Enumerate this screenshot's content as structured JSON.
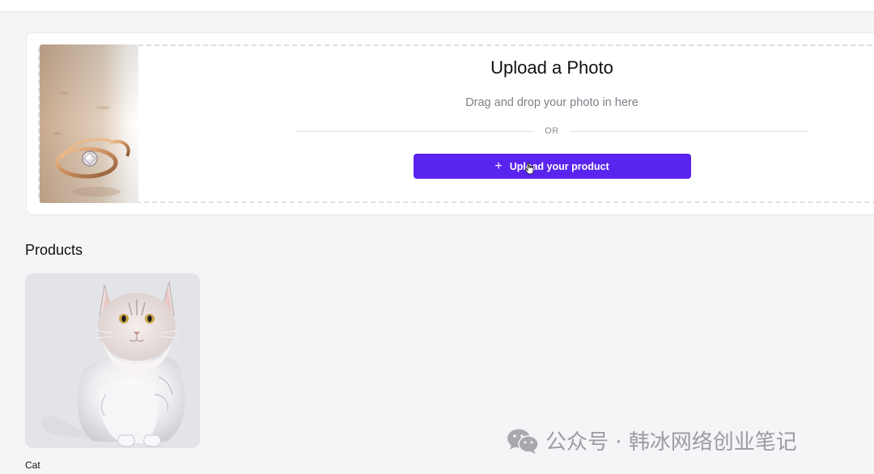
{
  "upload": {
    "title": "Upload a Photo",
    "subtitle": "Drag and drop your photo in here",
    "divider_text": "OR",
    "button_label": "Upload your product",
    "button_icon": "plus-icon",
    "accent_color": "#5a24ef"
  },
  "products": {
    "section_title": "Products",
    "items": [
      {
        "name": "Cat"
      }
    ]
  },
  "watermark": {
    "text": "公众号 · 韩冰网络创业笔记"
  }
}
